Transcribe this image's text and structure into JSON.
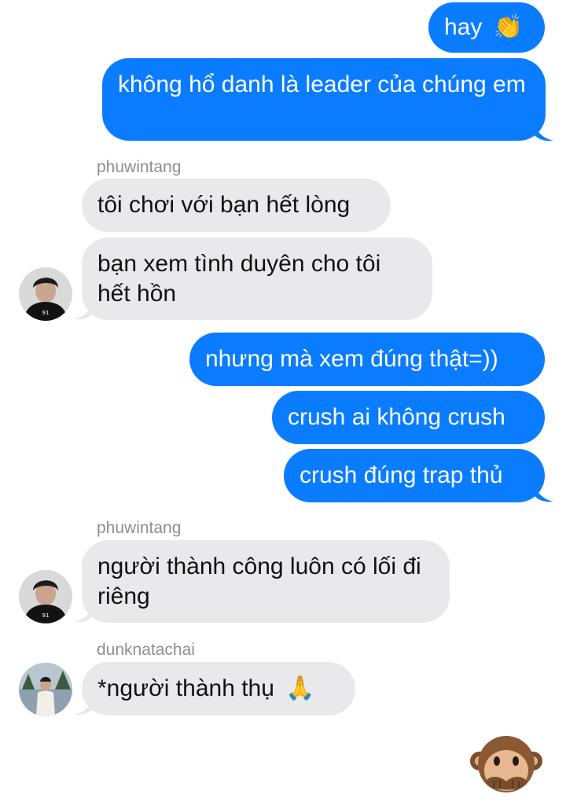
{
  "messages": [
    {
      "text": "hay",
      "emoji": "👏"
    },
    {
      "text": "không hổ danh là leader của chúng em"
    },
    {
      "sender": "phuwintang"
    },
    {
      "text": "tôi chơi với bạn hết lòng"
    },
    {
      "text": "bạn xem tình duyên cho tôi hết hồn"
    },
    {
      "text": "nhưng mà xem đúng thật=))"
    },
    {
      "text": "crush ai không crush"
    },
    {
      "text": "crush đúng trap thủ"
    },
    {
      "sender": "phuwintang"
    },
    {
      "text": "người thành công luôn có lối đi riêng"
    },
    {
      "sender": "dunknatachai"
    },
    {
      "text": "*người thành thụ",
      "emoji": "🙏"
    }
  ],
  "sticker": {
    "name": "speak-no-evil-monkey",
    "emoji": "🙊"
  },
  "colors": {
    "outgoing": "#0a7cff",
    "incoming": "#e9e9eb",
    "sender": "#8e8e93"
  }
}
